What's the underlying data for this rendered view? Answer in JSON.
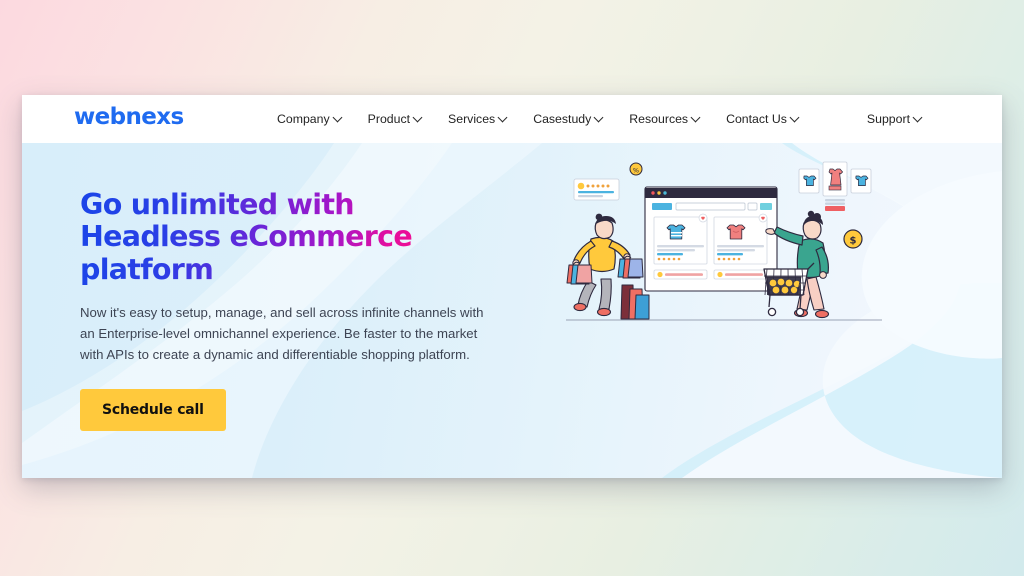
{
  "page": {
    "background_gradient_from": "#fcd9e0",
    "background_gradient_to": "#d2eaec"
  },
  "navbar": {
    "logo": "webnexs",
    "logo_color": "#1f6bf0",
    "links": [
      {
        "label": "Company",
        "has_dropdown": true,
        "icon": "chevron-down-icon"
      },
      {
        "label": "Product",
        "has_dropdown": true,
        "icon": "chevron-down-icon"
      },
      {
        "label": "Services",
        "has_dropdown": true,
        "icon": "chevron-down-icon"
      },
      {
        "label": "Casestudy",
        "has_dropdown": true,
        "icon": "chevron-down-icon"
      },
      {
        "label": "Resources",
        "has_dropdown": true,
        "icon": "chevron-down-icon"
      },
      {
        "label": "Contact Us",
        "has_dropdown": true,
        "icon": "chevron-down-icon"
      }
    ],
    "support": {
      "label": "Support",
      "has_dropdown": true,
      "icon": "chevron-down-icon"
    }
  },
  "hero": {
    "headline_line1": "Go unlimited with",
    "headline_line2": "Headless eCommerce",
    "headline_line3": "platform",
    "headline_gradient_from": "#1a45e8",
    "headline_gradient_to": "#f50d8e",
    "paragraph": "Now it's easy to setup, manage, and sell across infinite channels with an Enterprise-level omnichannel experience. Be faster to the market with APIs to create a dynamic and differentiable shopping platform.",
    "cta_label": "Schedule call",
    "cta_background": "#ffc93c",
    "cta_text_color": "#101010",
    "background_color": "#d8eefa",
    "illustration": {
      "name": "ecommerce-shopping-illustration",
      "browser_window": {
        "dots": [
          "#f2565b",
          "#f7c13f",
          "#4bb9d6"
        ],
        "product_cards": [
          {
            "item": "blue-striped-tshirt",
            "color": "#4bb3e0",
            "favorite": true
          },
          {
            "item": "pink-tshirt",
            "color": "#f0807f",
            "favorite": true
          }
        ]
      },
      "left_character": {
        "top_color": "#ffc93c",
        "pants_color": "#b4b4bb",
        "holding": "shopping-bags"
      },
      "right_character": {
        "top_color": "#3aa58f",
        "pants_color": "#f8cfc4",
        "pushing": "shopping-cart"
      },
      "floating_elements": [
        {
          "name": "rating-card",
          "stars": 5
        },
        {
          "name": "discount-coin-badge"
        },
        {
          "name": "dollar-coin-badge",
          "symbol": "$"
        },
        {
          "name": "product-thumbnail-left",
          "item": "blue-tshirt"
        },
        {
          "name": "product-thumbnail-center",
          "item": "pink-dress"
        },
        {
          "name": "product-thumbnail-right",
          "item": "blue-tshirt"
        }
      ]
    }
  }
}
